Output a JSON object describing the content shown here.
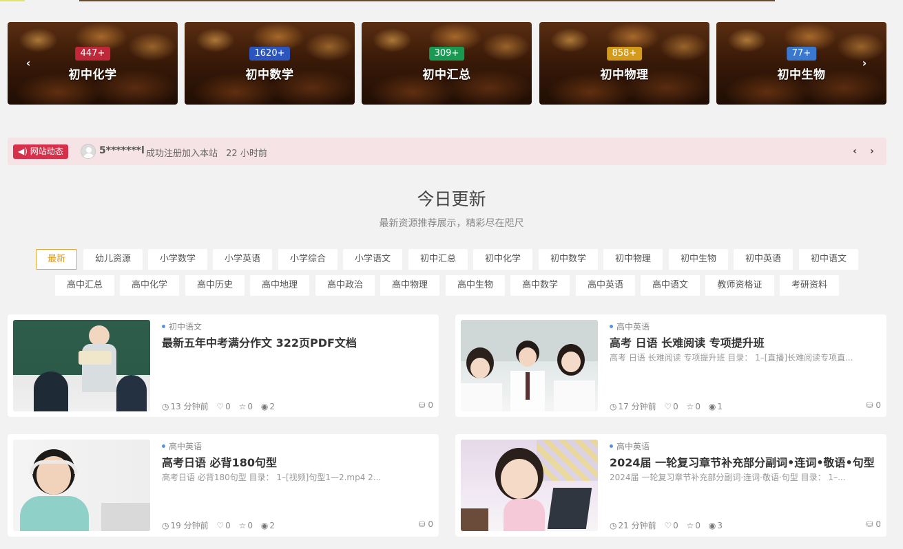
{
  "categories": [
    {
      "count": "447+",
      "name": "初中化学",
      "color": "#c0283a"
    },
    {
      "count": "1620+",
      "name": "初中数学",
      "color": "#2b56c0"
    },
    {
      "count": "309+",
      "name": "初中汇总",
      "color": "#199a52"
    },
    {
      "count": "858+",
      "name": "初中物理",
      "color": "#d49a1a"
    },
    {
      "count": "77+",
      "name": "初中生物",
      "color": "#3a78d0"
    }
  ],
  "carousel": {
    "prev": "‹",
    "next": "›"
  },
  "notice": {
    "tag": "◀) 网站动态",
    "user": "5*******l",
    "action": "成功注册加入本站",
    "time": "22 小时前",
    "prev": "‹",
    "next": "›"
  },
  "section": {
    "title": "今日更新",
    "subtitle": "最新资源推荐展示，精彩尽在咫尺"
  },
  "tabs_row1": [
    "最新",
    "幼儿资源",
    "小学数学",
    "小学英语",
    "小学综合",
    "小学语文",
    "初中汇总",
    "初中化学",
    "初中数学",
    "初中物理",
    "初中生物",
    "初中英语",
    "初中语文"
  ],
  "tabs_row2": [
    "高中汇总",
    "高中化学",
    "高中历史",
    "高中地理",
    "高中政治",
    "高中物理",
    "高中生物",
    "高中数学",
    "高中英语",
    "高中语文",
    "教师资格证",
    "考研资料"
  ],
  "posts": [
    {
      "category": "初中语文",
      "title": "最新五年中考满分作文 322页PDF文档",
      "desc": "",
      "time": "13 分钟前",
      "likes": "0",
      "stars": "0",
      "views": "2",
      "coins": "0"
    },
    {
      "category": "高中英语",
      "title": "高考 日语 长难阅读 专项提升班",
      "desc": "高考 日语 长难阅读 专项提升班 目录： 1–[直播]长难阅读专项直...",
      "time": "17 分钟前",
      "likes": "0",
      "stars": "0",
      "views": "1",
      "coins": "0"
    },
    {
      "category": "高中英语",
      "title": "高考日语 必背180句型",
      "desc": "高考日语 必背180句型 目录： 1–[视频]句型1—2.mp4 2...",
      "time": "19 分钟前",
      "likes": "0",
      "stars": "0",
      "views": "2",
      "coins": "0"
    },
    {
      "category": "高中英语",
      "title": "2024届 一轮复习章节补充部分副词•连词•敬语•句型",
      "desc": "2024届 一轮复习章节补充部分副词·连词·敬语·句型 目录： 1–...",
      "time": "21 分钟前",
      "likes": "0",
      "stars": "0",
      "views": "3",
      "coins": "0"
    }
  ],
  "icons": {
    "clock": "clock-icon",
    "heart": "heart-icon",
    "star": "star-icon",
    "eye": "eye-icon",
    "coin": "coin-icon"
  }
}
